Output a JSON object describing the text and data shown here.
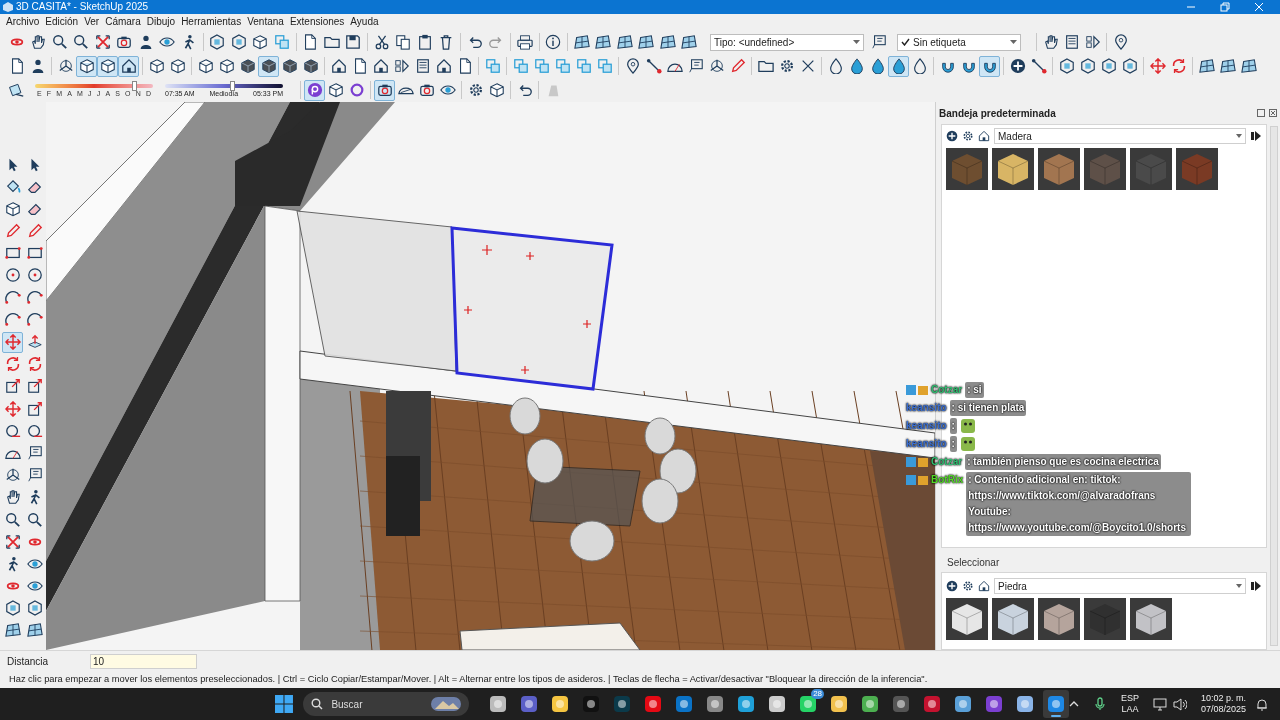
{
  "window": {
    "title": "3D CASITA* - SketchUp 2025"
  },
  "menu": [
    "Archivo",
    "Edición",
    "Ver",
    "Cámara",
    "Dibujo",
    "Herramientas",
    "Ventana",
    "Extensiones",
    "Ayuda"
  ],
  "toolbar_row_1": {
    "type_dropdown": "Tipo: <undefined>",
    "tag_dropdown": "Sin etiqueta"
  },
  "toolbar_row_2": [
    {
      "selected": false
    },
    {
      "selected": false
    },
    {
      "selected": false
    },
    {
      "selected": true
    },
    {
      "selected": true
    },
    {
      "selected": true
    },
    {
      "selected": false
    },
    {
      "selected": false
    },
    {
      "selected": false
    },
    {
      "selected": false
    },
    {
      "selected": false
    },
    {
      "selected": true
    },
    {
      "selected": false
    },
    {
      "selected": false
    },
    {
      "selected": false
    },
    {
      "selected": false
    },
    {
      "selected": false
    },
    {
      "selected": false
    },
    {
      "selected": false
    },
    {
      "selected": false
    },
    {
      "selected": false
    },
    {
      "selected": false
    },
    {
      "selected": false
    },
    {
      "selected": false
    },
    {
      "selected": false
    },
    {
      "selected": false
    },
    {
      "selected": false
    },
    {
      "selected": false
    },
    {
      "selected": false
    },
    {
      "selected": false
    },
    {
      "selected": false
    },
    {
      "selected": false
    },
    {
      "selected": false
    },
    {
      "selected": false
    },
    {
      "selected": false
    },
    {
      "selected": false
    },
    {
      "selected": false
    },
    {
      "selected": false
    },
    {
      "selected": false
    },
    {
      "selected": true
    },
    {
      "selected": false
    },
    {
      "selected": false
    },
    {
      "selected": false
    },
    {
      "selected": true
    },
    {
      "selected": false
    },
    {
      "selected": false
    },
    {
      "selected": false
    },
    {
      "selected": false
    },
    {
      "selected": false
    },
    {
      "selected": false
    },
    {
      "selected": false
    },
    {
      "selected": false
    },
    {
      "selected": false
    },
    {
      "selected": false
    },
    {
      "selected": false
    }
  ],
  "shadows": {
    "months": [
      "E",
      "F",
      "M",
      "A",
      "M",
      "J",
      "J",
      "A",
      "S",
      "O",
      "N",
      "D"
    ],
    "month_slider": {
      "level": 0.84
    },
    "time_start": "07:35 AM",
    "time_middle": "Mediodía",
    "time_end": "05:33 PM",
    "time_slider": {
      "level": 0.57
    }
  },
  "toolbar_row_3": [
    {
      "selected": true
    },
    {
      "selected": false
    },
    {
      "selected": false
    },
    {
      "selected": true
    },
    {
      "selected": false
    },
    {
      "selected": false
    },
    {
      "selected": false
    },
    {
      "selected": false
    },
    {
      "selected": false
    },
    {
      "selected": false
    },
    {
      "selected": false
    }
  ],
  "left_toolbar": [
    {
      "selected": false
    },
    {
      "selected": false
    },
    {
      "selected": false
    },
    {
      "selected": false
    },
    {
      "selected": false
    },
    {
      "selected": false
    },
    {
      "selected": false
    },
    {
      "selected": false
    },
    {
      "selected": false
    },
    {
      "selected": false
    },
    {
      "selected": false
    },
    {
      "selected": false
    },
    {
      "selected": false
    },
    {
      "selected": false
    },
    {
      "selected": false
    },
    {
      "selected": false
    },
    {
      "selected": true
    },
    {
      "selected": false
    },
    {
      "selected": false
    },
    {
      "selected": false
    },
    {
      "selected": false
    },
    {
      "selected": false
    },
    {
      "selected": false
    },
    {
      "selected": false
    },
    {
      "selected": false
    },
    {
      "selected": false
    },
    {
      "selected": false
    },
    {
      "selected": false
    },
    {
      "selected": false
    },
    {
      "selected": false
    },
    {
      "selected": false
    },
    {
      "selected": false
    },
    {
      "selected": false
    },
    {
      "selected": false
    },
    {
      "selected": false
    },
    {
      "selected": false
    },
    {
      "selected": false
    },
    {
      "selected": false
    },
    {
      "selected": false
    },
    {
      "selected": false
    },
    {
      "selected": false
    },
    {
      "selected": false
    },
    {
      "selected": false
    },
    {
      "selected": false
    }
  ],
  "chat": [
    {
      "user": "Cotzar",
      "color": "#2fbf71",
      "badged": true,
      "kind": "text",
      "text": ": si"
    },
    {
      "user": "keansito",
      "color": "#3b6fd1",
      "badged": false,
      "kind": "text",
      "text": ": si tienen plata"
    },
    {
      "user": "keansito",
      "color": "#3b6fd1",
      "badged": false,
      "kind": "emote",
      "text": ":"
    },
    {
      "user": "keansito",
      "color": "#3b6fd1",
      "badged": false,
      "kind": "emote",
      "text": ":"
    },
    {
      "user": "Cotzar",
      "color": "#2fbf71",
      "badged": true,
      "kind": "text",
      "text": ": también pienso que es cocina electrica"
    },
    {
      "user": "BotRix",
      "color": "#52d826",
      "badged": true,
      "kind": "text",
      "text": ": Contenido adicional en: tiktok: https://www.tiktok.com/@alvaradofrans Youtube: https://www.youtube.com/@Boycito1.0/shorts"
    }
  ],
  "tray": {
    "title": "Bandeja predeterminada",
    "materials": {
      "library": "Madera",
      "swatches": [
        {
          "color": "#6e4e30"
        },
        {
          "color": "#d8b565"
        },
        {
          "color": "#a27550"
        },
        {
          "color": "#5e5048"
        },
        {
          "color": "#4a4a4a"
        },
        {
          "color": "#7a3a24"
        }
      ]
    },
    "select_label": "Seleccionar",
    "materials_2": {
      "library": "Piedra",
      "swatches": [
        {
          "color": "#e6e6e6"
        },
        {
          "color": "#c9d3de"
        },
        {
          "color": "#b5a49c"
        },
        {
          "color": "#303030"
        },
        {
          "color": "#c2c2c6"
        }
      ]
    }
  },
  "measurements": {
    "label": "Distancia",
    "value": "10"
  },
  "status_bar": "Haz clic para empezar a mover los elementos preseleccionados. | Ctrl = Ciclo Copiar/Estampar/Mover. | Alt = Alternar entre los tipos de asideros. | Teclas de flecha = Activar/desactivar \"Bloquear la dirección de la inferencia\".",
  "taskbar": {
    "search": "Buscar",
    "apps": [
      {
        "selected": false
      },
      {
        "selected": false
      },
      {
        "selected": false
      },
      {
        "selected": false
      },
      {
        "selected": false
      },
      {
        "selected": false
      },
      {
        "selected": false
      },
      {
        "selected": false
      },
      {
        "selected": false
      },
      {
        "selected": false
      },
      {
        "selected": false,
        "badge": "28"
      },
      {
        "selected": false
      },
      {
        "selected": false
      },
      {
        "selected": false
      },
      {
        "selected": false
      },
      {
        "selected": false
      },
      {
        "selected": false
      },
      {
        "selected": false
      },
      {
        "selected": true
      }
    ],
    "language": "ESP",
    "layout": "LAA",
    "time": "10:02 p. m.",
    "date": "07/08/2025"
  }
}
